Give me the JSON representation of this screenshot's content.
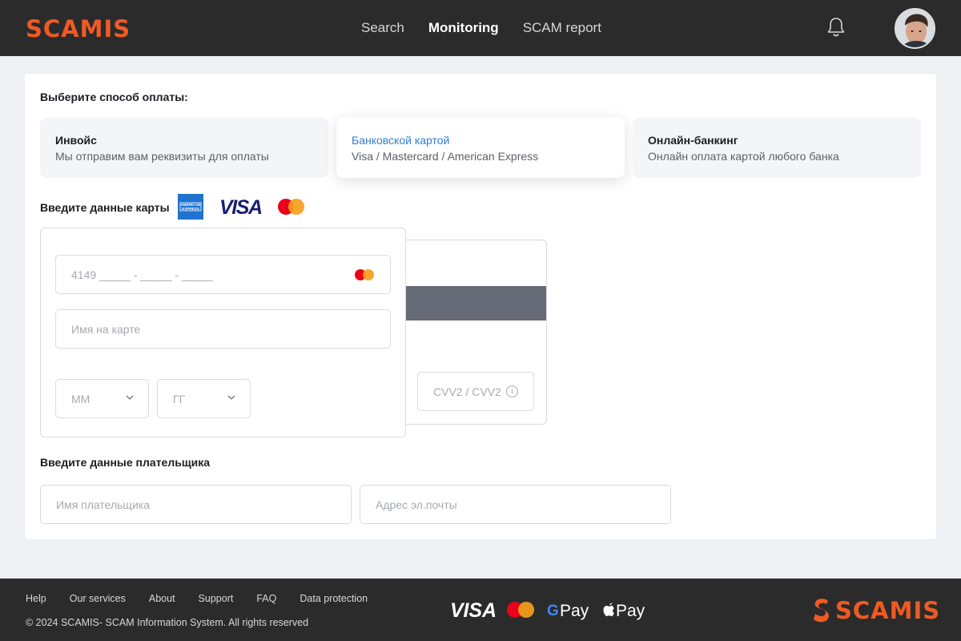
{
  "header": {
    "logo": "SCAMIS",
    "nav": [
      {
        "label": "Search"
      },
      {
        "label": "Monitoring"
      },
      {
        "label": "SCAM report"
      }
    ]
  },
  "payment": {
    "title": "Выберите способ оплаты:",
    "methods": [
      {
        "title": "Инвойс",
        "subtitle": "Мы отправим вам реквизиты для оплаты"
      },
      {
        "title": "Банковской картой",
        "subtitle": "Visa / Mastercard / American Express"
      },
      {
        "title": "Онлайн-банкинг",
        "subtitle": "Онлайн оплата картой любого банка"
      }
    ]
  },
  "card": {
    "title": "Введите данные карты",
    "brand_logos": {
      "amex": "AMERICAN EXPRESS",
      "visa": "VISA"
    },
    "number_placeholder": "4149 _____ - _____ - _____",
    "name_placeholder": "Имя на карте",
    "month_placeholder": "ММ",
    "year_placeholder": "ГГ",
    "cvv_placeholder": "CVV2 / CVV2"
  },
  "payer": {
    "title": "Введите данные плательщика",
    "name_placeholder": "Имя плательщика",
    "email_placeholder": "Адрес эл.почты"
  },
  "footer": {
    "links": [
      {
        "label": "Help"
      },
      {
        "label": "Our services"
      },
      {
        "label": "About"
      },
      {
        "label": "Support"
      },
      {
        "label": "FAQ"
      },
      {
        "label": "Data protection"
      }
    ],
    "copyright": "© 2024  SCAMIS- SCAM Information System.  All rights reserved",
    "pay_logos": {
      "visa": "VISA",
      "gpay": "Pay",
      "applepay": "Pay"
    },
    "logo": "SCAMIS"
  },
  "colors": {
    "brand": "#ee5a24",
    "accent": "#2f7dd8",
    "header_bg": "#2b2b2b"
  }
}
